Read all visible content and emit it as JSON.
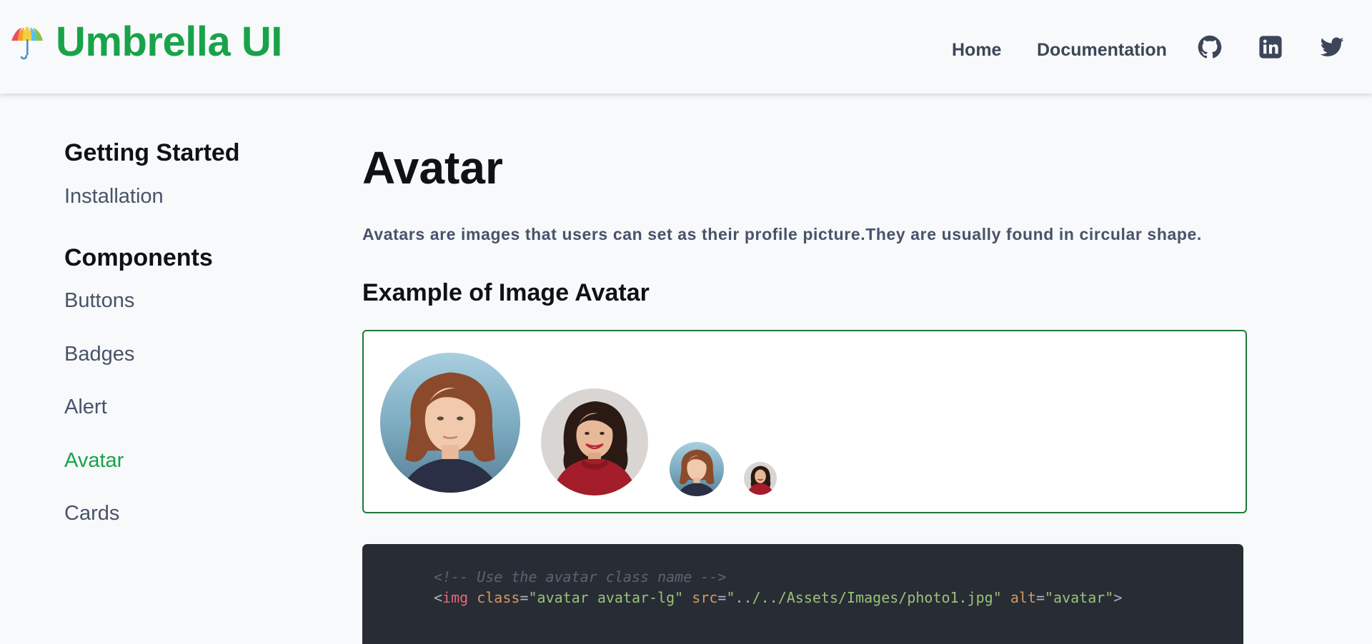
{
  "header": {
    "brand_title": "Umbrella UI",
    "brand_icon": "umbrella-icon",
    "nav_links": [
      {
        "label": "Home"
      },
      {
        "label": "Documentation"
      }
    ],
    "social_icons": [
      "github-icon",
      "linkedin-icon",
      "twitter-icon"
    ],
    "brand_color": "#18a34a"
  },
  "sidebar": {
    "sections": [
      {
        "heading": "Getting Started",
        "items": [
          {
            "label": "Installation",
            "active": false
          }
        ]
      },
      {
        "heading": "Components",
        "items": [
          {
            "label": "Buttons",
            "active": false
          },
          {
            "label": "Badges",
            "active": false
          },
          {
            "label": "Alert",
            "active": false
          },
          {
            "label": "Avatar",
            "active": true
          },
          {
            "label": "Cards",
            "active": false
          }
        ]
      }
    ]
  },
  "main": {
    "title": "Avatar",
    "description": "Avatars are images that users can set as their profile picture.They are usually found in circular shape.",
    "example_heading": "Example of Image Avatar",
    "avatars": [
      {
        "size_class": "avatar-lg",
        "photo": "photo1",
        "alt": "avatar"
      },
      {
        "size_class": "avatar-md",
        "photo": "photo2",
        "alt": "avatar"
      },
      {
        "size_class": "avatar-sm",
        "photo": "photo1",
        "alt": "avatar"
      },
      {
        "size_class": "avatar-xs",
        "photo": "photo2",
        "alt": "avatar"
      }
    ],
    "code": {
      "comment": "<!-- Use the avatar class name -->",
      "line1": {
        "open": "<",
        "tag": "img",
        "attr_class": "class",
        "eq1": "=",
        "val_class": "\"avatar avatar-lg\"",
        "attr_src": "src",
        "eq2": "=",
        "val_src": "\"../../Assets/Images/photo1.jpg\"",
        "attr_alt": "alt",
        "eq3": "=",
        "val_alt": "\"avatar\"",
        "close": ">"
      }
    }
  }
}
